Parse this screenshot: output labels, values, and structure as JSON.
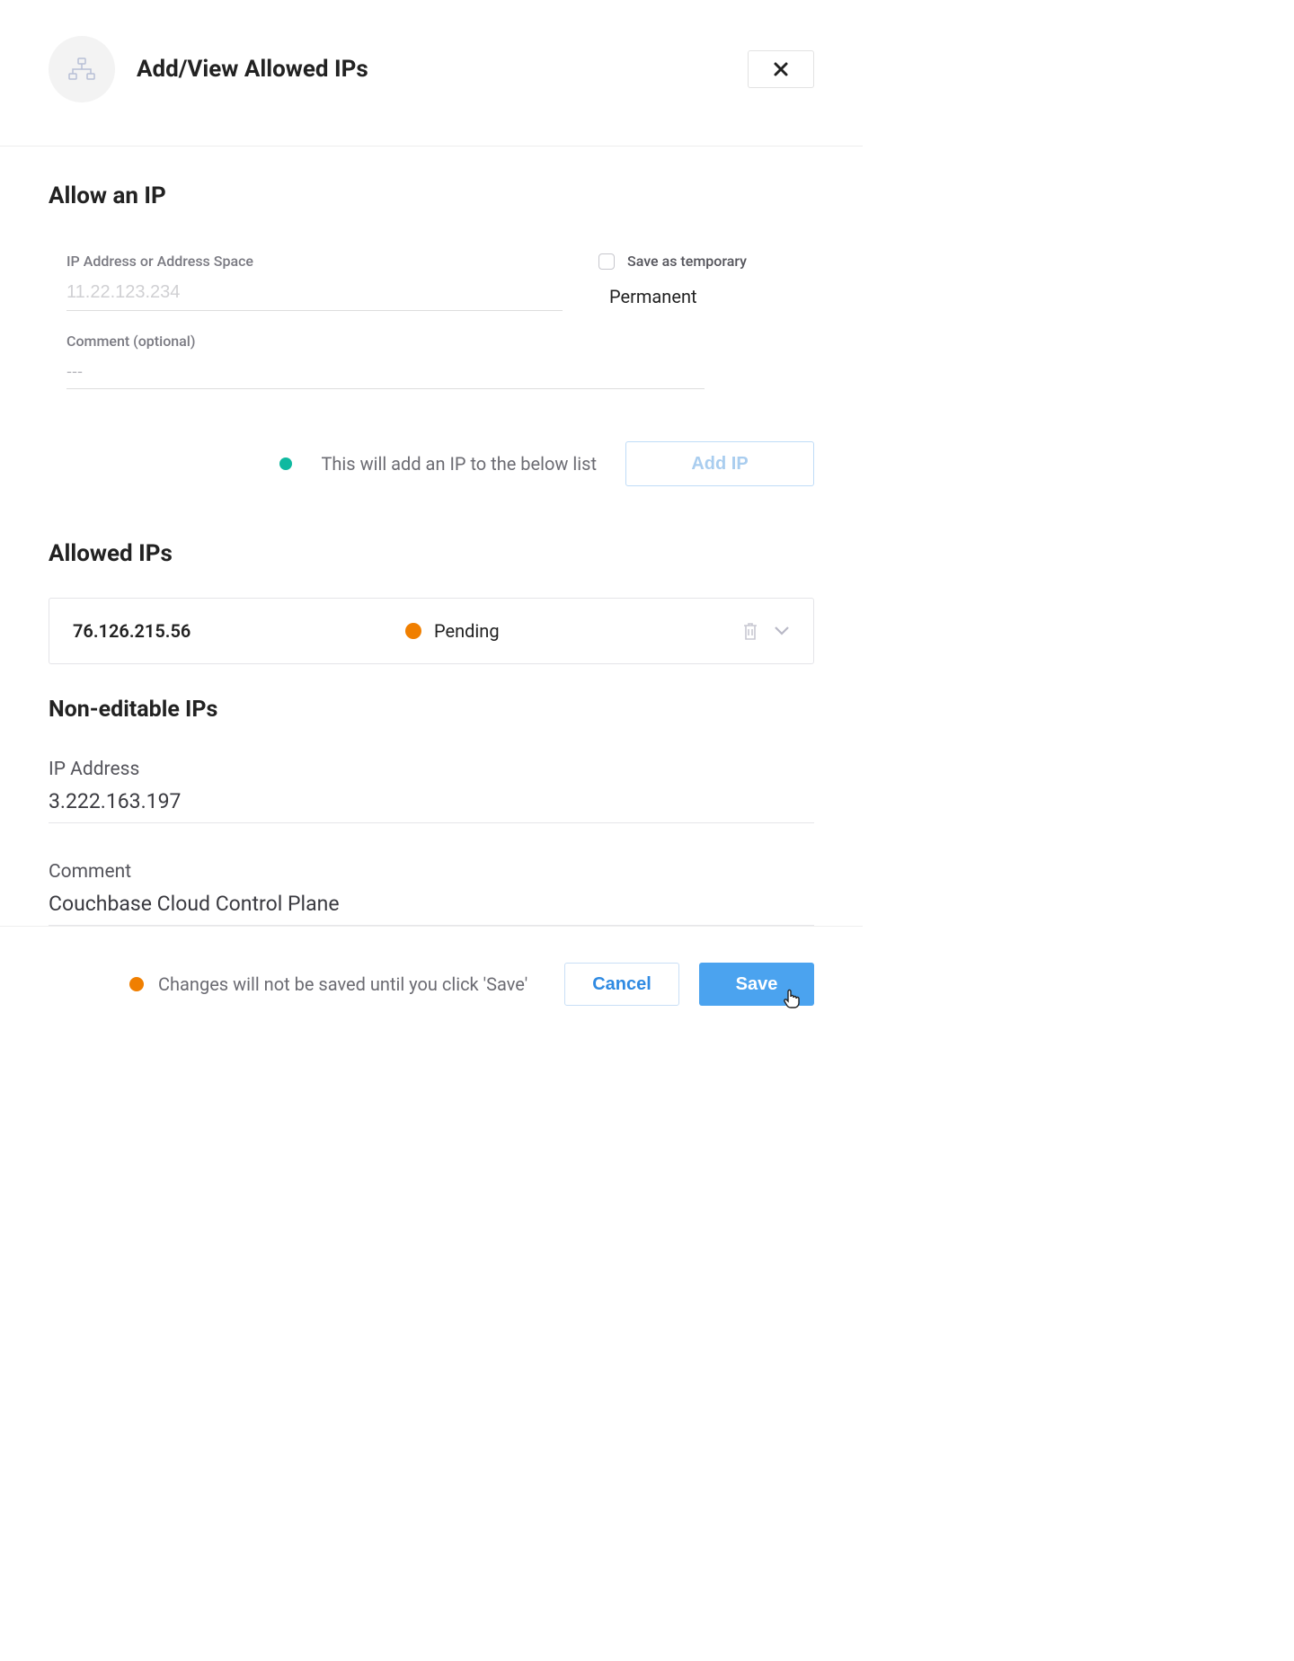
{
  "header": {
    "title": "Add/View Allowed IPs"
  },
  "allow_section": {
    "heading": "Allow an IP",
    "ip_label": "IP Address or Address Space",
    "ip_placeholder": "11.22.123.234",
    "save_temp_label": "Save as temporary",
    "permanent_text": "Permanent",
    "comment_label": "Comment (optional)",
    "comment_value": "---",
    "info_text": "This will add an IP to the below list",
    "add_ip_label": "Add IP"
  },
  "allowed_section": {
    "heading": "Allowed IPs",
    "rows": [
      {
        "ip": "76.126.215.56",
        "status": "Pending"
      }
    ]
  },
  "noneditable_section": {
    "heading": "Non-editable IPs",
    "ip_label": "IP Address",
    "ip_value": "3.222.163.197",
    "comment_label": "Comment",
    "comment_value": "Couchbase Cloud Control Plane"
  },
  "footer": {
    "warn_text": "Changes will not be saved until you click 'Save'",
    "cancel_label": "Cancel",
    "save_label": "Save"
  }
}
